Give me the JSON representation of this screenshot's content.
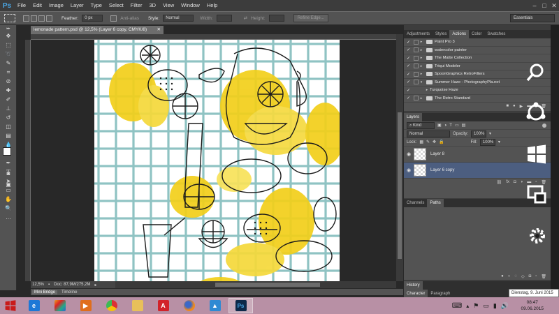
{
  "app": {
    "logo": "Ps"
  },
  "menu": [
    "File",
    "Edit",
    "Image",
    "Layer",
    "Type",
    "Select",
    "Filter",
    "3D",
    "View",
    "Window",
    "Help"
  ],
  "options": {
    "feather_label": "Feather:",
    "feather_value": "0 px",
    "antialias_label": "Anti-alias",
    "style_label": "Style:",
    "style_value": "Normal",
    "width_label": "Width:",
    "height_label": "Height:",
    "refine_label": "Refine Edge...",
    "workspace": "Essentials"
  },
  "document": {
    "tab_title": "lemonade pattern.psd @ 12,5% (Layer 6 copy, CMYK/8)",
    "zoom": "12,5%",
    "doc_info": "Doc: 87,9M/275,2M"
  },
  "bottom_tabs": [
    "Mini Bridge",
    "Timeline"
  ],
  "panels": {
    "top_tabs": [
      "Adjustments",
      "Styles",
      "Actions",
      "Color",
      "Swatches"
    ],
    "actions": [
      "Paint Pro 3",
      "watercolor painter",
      "The Matte Collection",
      "Triqui Modeler",
      "SpoonGraphics RetroFilters",
      "Summer Haze - PhotographyPla.net",
      "Turquoise Haze",
      "The Retro Standard"
    ],
    "layers_tab": "Layers",
    "kind_label": "Kind",
    "blend_mode": "Normal",
    "opacity_label": "Opacity:",
    "opacity_value": "100%",
    "lock_label": "Lock:",
    "fill_label": "Fill:",
    "fill_value": "100%",
    "layers": [
      "Layer 8",
      "Layer 6 copy"
    ],
    "channels_tabs": [
      "Channels",
      "Paths"
    ],
    "history_tab": "History",
    "char_tabs": [
      "Character",
      "Paragraph"
    ]
  },
  "taskbar": {
    "time": "08:47",
    "date": "09.06.2015",
    "tooltip": "Dienstag, 9. Juni 2015"
  },
  "colors": {
    "grid": "#8fc3c3",
    "lemon": "#f2cf1a",
    "lemon_light": "#f8e25a",
    "taskbar": "#b890a5"
  }
}
